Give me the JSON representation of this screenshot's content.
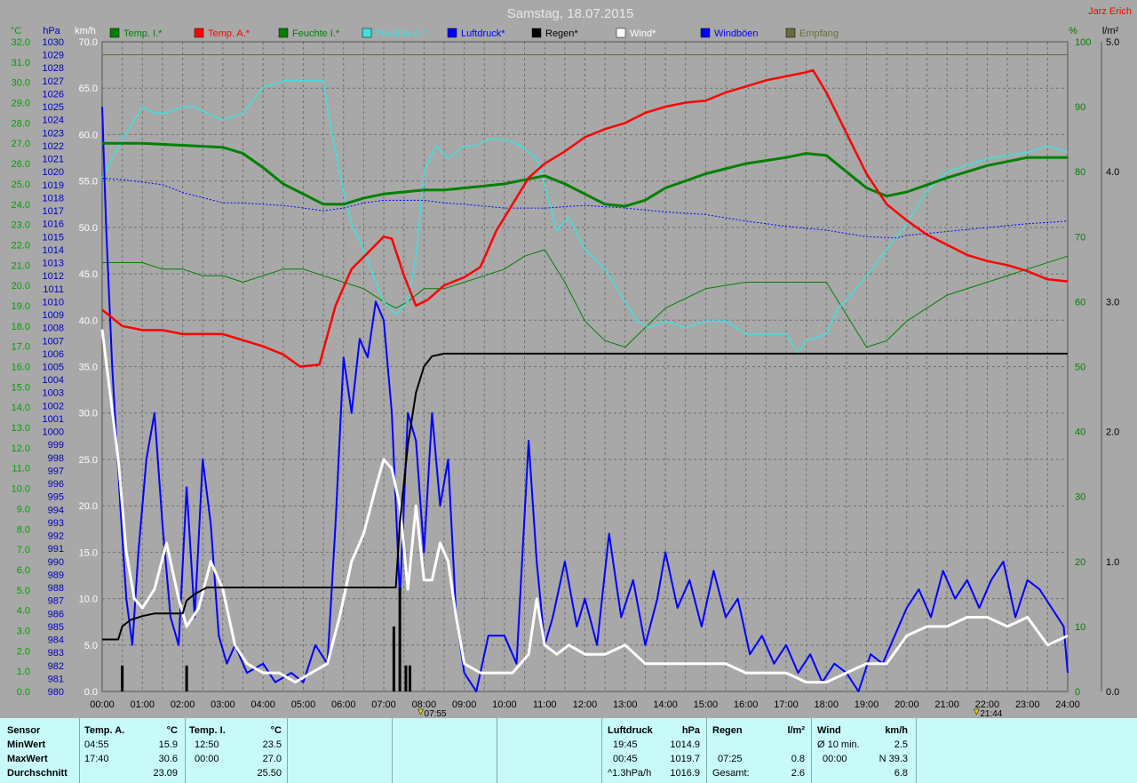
{
  "title": "Samstag, 18.07.2015",
  "author": "Jarz Erich",
  "axes": {
    "left_units": [
      "°C",
      "hPa",
      "km/h"
    ],
    "right_units": [
      "%",
      "l/m²"
    ],
    "temp_ticks": [
      "32.0",
      "31.0",
      "30.0",
      "29.0",
      "28.0",
      "27.0",
      "26.0",
      "25.0",
      "24.0",
      "23.0",
      "22.0",
      "21.0",
      "20.0",
      "19.0",
      "18.0",
      "17.0",
      "16.0",
      "15.0",
      "14.0",
      "13.0",
      "12.0",
      "11.0",
      "10.0",
      "9.0",
      "8.0",
      "7.0",
      "6.0",
      "5.0",
      "4.0",
      "3.0",
      "2.0",
      "1.0",
      "0.0"
    ],
    "kmh_ticks": [
      "70.0",
      "65.0",
      "60.0",
      "55.0",
      "50.0",
      "45.0",
      "40.0",
      "35.0",
      "30.0",
      "25.0",
      "20.0",
      "15.0",
      "10.0",
      "5.0",
      "0.0"
    ],
    "pct_ticks": [
      "100",
      "90",
      "80",
      "70",
      "60",
      "50",
      "40",
      "30",
      "20",
      "10",
      "0"
    ],
    "rain_ticks": [
      "5.0",
      "4.0",
      "3.0",
      "2.0",
      "1.0",
      "0.0"
    ],
    "time_ticks": [
      "00:00",
      "01:00",
      "02:00",
      "03:00",
      "04:00",
      "05:00",
      "06:00",
      "07:00",
      "08:00",
      "09:00",
      "10:00",
      "11:00",
      "12:00",
      "13:00",
      "14:00",
      "15:00",
      "16:00",
      "17:00",
      "18:00",
      "19:00",
      "20:00",
      "21:00",
      "22:00",
      "23:00",
      "24:00"
    ],
    "sunrise": "07:55",
    "sunset": "21:44"
  },
  "colors": {
    "background": "#a8a8a8",
    "grid": "#6f6f6f",
    "temp_in": "#008000",
    "temp_out": "#ff0000",
    "hum_in": "#008000",
    "hum_out": "#40e0e0",
    "pressure": "#0000ff",
    "rain": "#000000",
    "wind": "#ffffff",
    "gusts": "#0000ff",
    "reception": "#6b6b3a",
    "temp_axis": "#00a000",
    "pressure_axis": "#0000c0",
    "kmh_axis": "#ffffff",
    "pct_axis": "#008000",
    "bottom_panel": "#c8fafa"
  },
  "chart_data": {
    "type": "line",
    "title": "Samstag, 18.07.2015",
    "x_unit": "hours",
    "xlim": [
      0,
      24
    ],
    "ylim_temp": [
      0,
      32
    ],
    "ylim_pressure": [
      980,
      1030
    ],
    "ylim_kmh": [
      0,
      70
    ],
    "ylim_pct": [
      0,
      100
    ],
    "ylim_rain": [
      0,
      5
    ],
    "grid": true,
    "legend_position": "top",
    "legend": [
      "Temp. I.*",
      "Temp. A.*",
      "Feuchte I.*",
      "Feuchte A.*",
      "Luftdruck*",
      "Regen*",
      "Wind*",
      "Windböen",
      "Empfang"
    ],
    "series": [
      {
        "name": "Temp. A.*",
        "axis": "temp",
        "x": [
          0,
          0.5,
          1,
          1.5,
          2,
          2.5,
          3,
          3.5,
          4,
          4.5,
          4.92,
          5.4,
          5.8,
          6.2,
          6.6,
          7,
          7.2,
          7.5,
          7.8,
          8.1,
          8.5,
          9,
          9.4,
          9.8,
          10.2,
          10.6,
          11,
          11.5,
          12,
          12.5,
          13,
          13.5,
          14,
          14.5,
          15,
          15.5,
          16,
          16.5,
          17,
          17.5,
          17.67,
          18,
          18.5,
          19,
          19.5,
          20,
          20.5,
          21,
          21.5,
          22,
          22.5,
          23,
          23.5,
          24
        ],
        "y": [
          18.8,
          18.0,
          17.8,
          17.8,
          17.6,
          17.6,
          17.6,
          17.3,
          17.0,
          16.6,
          16.0,
          16.1,
          19.0,
          20.8,
          21.6,
          22.4,
          22.3,
          20.5,
          19.0,
          19.3,
          20.0,
          20.4,
          20.9,
          22.7,
          24.0,
          25.3,
          26.0,
          26.6,
          27.3,
          27.7,
          28.0,
          28.5,
          28.8,
          29.0,
          29.1,
          29.5,
          29.8,
          30.1,
          30.3,
          30.5,
          30.6,
          29.5,
          27.5,
          25.5,
          24.0,
          23.2,
          22.5,
          22.0,
          21.5,
          21.2,
          21.0,
          20.7,
          20.3,
          20.2
        ]
      },
      {
        "name": "Temp. I.*",
        "axis": "temp",
        "x": [
          0,
          1,
          2,
          3,
          3.5,
          4,
          4.5,
          5,
          5.5,
          6,
          6.5,
          7,
          7.5,
          8,
          8.5,
          9,
          9.5,
          10,
          10.5,
          11,
          11.5,
          12,
          12.5,
          13,
          13.5,
          14,
          15,
          16,
          17,
          17.5,
          18,
          18.5,
          19,
          19.5,
          20,
          21,
          22,
          23,
          24
        ],
        "y": [
          27.0,
          27.0,
          26.9,
          26.8,
          26.5,
          25.8,
          25.0,
          24.5,
          24.0,
          24.0,
          24.3,
          24.5,
          24.6,
          24.7,
          24.7,
          24.8,
          24.9,
          25.0,
          25.2,
          25.4,
          25.0,
          24.5,
          24.0,
          23.9,
          24.2,
          24.8,
          25.5,
          26.0,
          26.3,
          26.5,
          26.4,
          25.6,
          24.8,
          24.4,
          24.6,
          25.3,
          25.9,
          26.3,
          26.3
        ]
      },
      {
        "name": "Feuchte A.*",
        "axis": "pct",
        "x": [
          0,
          0.25,
          0.5,
          0.8,
          1,
          1.3,
          1.6,
          2,
          2.3,
          2.6,
          3,
          3.5,
          4,
          4.5,
          5,
          5.5,
          5.7,
          6,
          6.2,
          6.5,
          6.8,
          7,
          7.3,
          7.6,
          7.8,
          8,
          8.3,
          8.6,
          9,
          9.3,
          9.6,
          10,
          10.4,
          10.8,
          11,
          11.3,
          11.6,
          12,
          12.5,
          13,
          13.3,
          13.6,
          14,
          14.5,
          15,
          15.5,
          16,
          16.5,
          17,
          17.3,
          17.5,
          18,
          18.3,
          18.6,
          19,
          19.5,
          20,
          20.5,
          21,
          22,
          23,
          23.5,
          24
        ],
        "y": [
          79,
          82,
          85,
          88,
          90,
          89,
          89,
          90,
          90,
          89,
          88,
          89,
          93,
          94,
          94,
          94,
          86,
          77,
          72,
          68,
          63,
          60,
          58,
          60,
          67,
          80,
          84,
          82,
          84,
          84,
          85,
          85,
          84,
          82,
          78,
          71,
          73,
          68,
          65,
          60,
          57,
          56,
          57,
          56,
          57,
          57,
          55,
          55,
          55,
          52,
          54,
          55,
          59,
          61,
          64,
          68,
          72,
          77,
          80,
          82,
          83,
          84,
          83
        ]
      },
      {
        "name": "Feuchte I.*",
        "axis": "pct",
        "x": [
          0,
          1,
          1.5,
          2,
          2.5,
          3,
          3.5,
          4,
          4.5,
          5,
          5.5,
          6,
          6.5,
          7,
          7.3,
          7.6,
          8,
          8.5,
          9,
          9.5,
          10,
          10.5,
          11,
          11.5,
          12,
          12.5,
          13,
          13.5,
          14,
          15,
          16,
          17,
          17.5,
          18,
          18.5,
          19,
          19.5,
          20,
          21,
          22,
          23,
          24
        ],
        "y": [
          66,
          66,
          65,
          65,
          64,
          64,
          63,
          64,
          65,
          65,
          64,
          63,
          62,
          60,
          59,
          60,
          62,
          62,
          63,
          64,
          65,
          67,
          68,
          63,
          57,
          54,
          53,
          56,
          59,
          62,
          63,
          63,
          63,
          63,
          58,
          53,
          54,
          57,
          61,
          63,
          65,
          67
        ]
      },
      {
        "name": "Luftdruck*",
        "axis": "pressure",
        "x": [
          0,
          0.5,
          1,
          1.5,
          2,
          2.5,
          3,
          3.5,
          4,
          4.5,
          5,
          5.5,
          6,
          6.5,
          7,
          7.5,
          8,
          8.5,
          9,
          10,
          11,
          12,
          13,
          14,
          15,
          16,
          17,
          18,
          19,
          19.75,
          20,
          21,
          22,
          23,
          24
        ],
        "y": [
          1019.5,
          1019.4,
          1019.2,
          1019.0,
          1018.4,
          1018.0,
          1017.6,
          1017.6,
          1017.5,
          1017.4,
          1017.2,
          1017.0,
          1017.2,
          1017.6,
          1017.8,
          1017.8,
          1017.8,
          1017.6,
          1017.5,
          1017.2,
          1017.2,
          1017.4,
          1017.2,
          1016.9,
          1016.7,
          1016.2,
          1015.8,
          1015.5,
          1015.0,
          1014.9,
          1015.1,
          1015.4,
          1015.7,
          1016.0,
          1016.2
        ]
      },
      {
        "name": "Regen*",
        "axis": "rain",
        "x": [
          0,
          0.4,
          0.5,
          0.7,
          1,
          1.3,
          1.6,
          2,
          2.1,
          2.3,
          2.6,
          3,
          4,
          5,
          6,
          7,
          7.3,
          7.4,
          7.6,
          7.8,
          8,
          8.2,
          8.5,
          9,
          10,
          11,
          12,
          13,
          14,
          16,
          18,
          20,
          22,
          24
        ],
        "y": [
          0.4,
          0.4,
          0.5,
          0.55,
          0.58,
          0.6,
          0.6,
          0.6,
          0.7,
          0.75,
          0.8,
          0.8,
          0.8,
          0.8,
          0.8,
          0.8,
          0.8,
          1.3,
          1.9,
          2.3,
          2.5,
          2.58,
          2.6,
          2.6,
          2.6,
          2.6,
          2.6,
          2.6,
          2.6,
          2.6,
          2.6,
          2.6,
          2.6,
          2.6
        ]
      },
      {
        "name": "Regen* Impulse",
        "axis": "rain",
        "x": [
          0.5,
          2.1,
          7.25,
          7.4,
          7.55,
          7.65
        ],
        "y": [
          0.2,
          0.2,
          0.5,
          0.8,
          0.2,
          0.2
        ]
      },
      {
        "name": "Wind*",
        "axis": "kmh",
        "x": [
          0,
          0.2,
          0.4,
          0.6,
          0.8,
          1,
          1.3,
          1.6,
          1.9,
          2.1,
          2.4,
          2.7,
          3,
          3.3,
          3.6,
          4,
          4.4,
          4.8,
          5.2,
          5.6,
          5.9,
          6.2,
          6.5,
          6.8,
          7,
          7.2,
          7.4,
          7.6,
          7.8,
          8,
          8.2,
          8.4,
          8.6,
          8.8,
          9,
          9.4,
          9.8,
          10.2,
          10.6,
          10.8,
          11,
          11.3,
          11.6,
          12,
          12.5,
          13,
          13.5,
          14,
          14.5,
          15,
          15.5,
          16,
          16.5,
          17,
          17.5,
          18,
          18.5,
          19,
          19.5,
          20,
          20.5,
          21,
          21.5,
          22,
          22.5,
          23,
          23.5,
          24
        ],
        "y": [
          39,
          32,
          25,
          15,
          10,
          9,
          11,
          16,
          10,
          7,
          9,
          14,
          11,
          5,
          3,
          2,
          2,
          1,
          2,
          3,
          8,
          14,
          17,
          22,
          25,
          24,
          20,
          11,
          20,
          12,
          12,
          16,
          14,
          8,
          3,
          2,
          2,
          2,
          4,
          10,
          5,
          4,
          5,
          4,
          4,
          5,
          3,
          3,
          3,
          3,
          3,
          2,
          2,
          2,
          1,
          1,
          2,
          3,
          3,
          6,
          7,
          7,
          8,
          8,
          7,
          8,
          5,
          6
        ]
      },
      {
        "name": "Windböen",
        "axis": "kmh",
        "x": [
          0,
          0.1,
          0.25,
          0.45,
          0.6,
          0.75,
          0.9,
          1.1,
          1.3,
          1.5,
          1.7,
          1.9,
          2.1,
          2.3,
          2.5,
          2.7,
          2.9,
          3.1,
          3.3,
          3.6,
          4,
          4.3,
          4.7,
          5,
          5.3,
          5.6,
          5.8,
          6,
          6.2,
          6.4,
          6.6,
          6.8,
          7,
          7.2,
          7.4,
          7.6,
          7.8,
          8,
          8.2,
          8.4,
          8.6,
          8.8,
          9,
          9.3,
          9.6,
          10,
          10.3,
          10.6,
          10.8,
          11,
          11.2,
          11.5,
          11.8,
          12,
          12.3,
          12.6,
          12.9,
          13.2,
          13.5,
          13.8,
          14,
          14.3,
          14.6,
          14.9,
          15.2,
          15.5,
          15.8,
          16.1,
          16.4,
          16.7,
          17,
          17.3,
          17.6,
          17.9,
          18.2,
          18.5,
          18.8,
          19.1,
          19.4,
          19.7,
          20,
          20.3,
          20.6,
          20.9,
          21.2,
          21.5,
          21.8,
          22.1,
          22.4,
          22.7,
          23,
          23.3,
          23.6,
          23.9,
          24
        ],
        "y": [
          63,
          50,
          35,
          20,
          10,
          5,
          15,
          25,
          30,
          18,
          8,
          5,
          22,
          8,
          25,
          18,
          6,
          3,
          5,
          2,
          3,
          1,
          2,
          1,
          5,
          3,
          18,
          36,
          30,
          38,
          36,
          42,
          40,
          30,
          10,
          30,
          27,
          15,
          30,
          20,
          25,
          8,
          2,
          0,
          6,
          6,
          3,
          27,
          14,
          5,
          8,
          14,
          7,
          10,
          5,
          17,
          8,
          12,
          5,
          10,
          15,
          9,
          12,
          7,
          13,
          8,
          10,
          4,
          6,
          3,
          5,
          2,
          4,
          1,
          3,
          2,
          0,
          4,
          3,
          6,
          9,
          11,
          8,
          13,
          10,
          12,
          9,
          12,
          14,
          8,
          12,
          11,
          9,
          7,
          2
        ]
      },
      {
        "name": "Empfang",
        "axis": "pct",
        "x": [
          0,
          2,
          4,
          6,
          8,
          10,
          12,
          14,
          16,
          18,
          20,
          22,
          24
        ],
        "y": [
          98,
          98,
          98,
          98,
          98,
          98,
          98,
          98,
          98,
          98,
          98,
          98,
          98
        ]
      }
    ]
  },
  "summary": {
    "headers": {
      "sensor": "Sensor",
      "temp_a": "Temp. A.",
      "temp_a_unit": "°C",
      "temp_i": "Temp. I.",
      "temp_i_unit": "°C",
      "luftdruck": "Luftdruck",
      "luftdruck_unit": "hPa",
      "regen": "Regen",
      "regen_unit": "l/m²",
      "wind": "Wind",
      "wind_unit": "km/h"
    },
    "row_labels": {
      "min": "MinWert",
      "max": "MaxWert",
      "avg": "Durchschnitt"
    },
    "temp_a": {
      "min_time": "04:55",
      "min": "15.9",
      "max_time": "17:40",
      "max": "30.6",
      "avg": "23.09"
    },
    "temp_i": {
      "min_time": "12:50",
      "min": "23.5",
      "max_time": "00:00",
      "max": "27.0",
      "avg": "25.50"
    },
    "luftdruck": {
      "min_time": "19:45",
      "min": "1014.9",
      "max_time": "00:45",
      "max": "1019.7",
      "avg_label": "^1.3hPa/h",
      "avg": "1016.9"
    },
    "regen": {
      "max_time": "07:25",
      "max": "0.8",
      "total_label": "Gesamt:",
      "total": "2.6"
    },
    "wind": {
      "min_label": "Ø 10 min.",
      "min": "2.5",
      "max_time": "00:00",
      "max": "N 39.3",
      "avg": "6.8"
    }
  }
}
